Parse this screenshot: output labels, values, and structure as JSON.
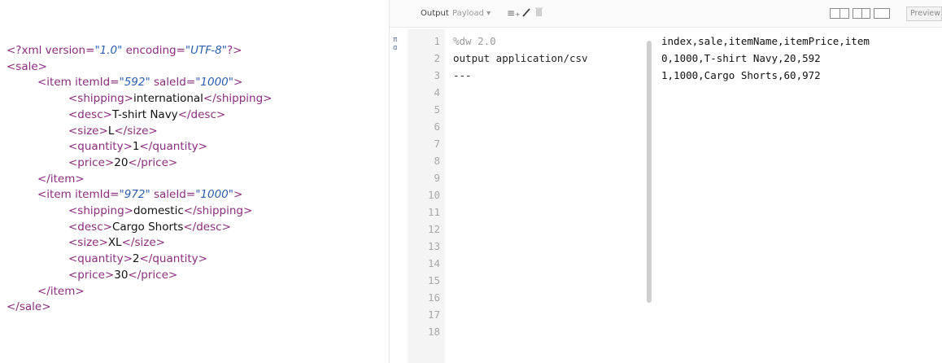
{
  "xml_source": {
    "lines": [
      {
        "indent": 0,
        "parts": [
          [
            "punct",
            "<?xml "
          ],
          [
            "attr",
            "version="
          ],
          [
            "aval",
            "\"1.0\""
          ],
          [
            "attr",
            " encoding="
          ],
          [
            "aval",
            "\"UTF-8\""
          ],
          [
            "punct",
            "?>"
          ]
        ]
      },
      {
        "indent": 0,
        "parts": [
          [
            "tag",
            "<sale>"
          ]
        ]
      },
      {
        "indent": 1,
        "parts": [
          [
            "tag",
            "<item "
          ],
          [
            "attr",
            "itemId="
          ],
          [
            "aval",
            "\"592\""
          ],
          [
            "attr",
            " saleId="
          ],
          [
            "aval",
            "\"1000\""
          ],
          [
            "tag",
            ">"
          ]
        ]
      },
      {
        "indent": 2,
        "parts": [
          [
            "tag",
            "<shipping>"
          ],
          [
            "txt",
            "international"
          ],
          [
            "tag",
            "</shipping>"
          ]
        ]
      },
      {
        "indent": 2,
        "parts": [
          [
            "tag",
            "<desc>"
          ],
          [
            "txt",
            "T-shirt Navy"
          ],
          [
            "tag",
            "</desc>"
          ]
        ]
      },
      {
        "indent": 2,
        "parts": [
          [
            "tag",
            "<size>"
          ],
          [
            "txt",
            "L"
          ],
          [
            "tag",
            "</size>"
          ]
        ]
      },
      {
        "indent": 2,
        "parts": [
          [
            "tag",
            "<quantity>"
          ],
          [
            "txt",
            "1"
          ],
          [
            "tag",
            "</quantity>"
          ]
        ]
      },
      {
        "indent": 2,
        "parts": [
          [
            "tag",
            "<price>"
          ],
          [
            "txt",
            "20"
          ],
          [
            "tag",
            "</price>"
          ]
        ]
      },
      {
        "indent": 1,
        "parts": [
          [
            "tag",
            "</item>"
          ]
        ]
      },
      {
        "indent": 1,
        "parts": [
          [
            "tag",
            "<item "
          ],
          [
            "attr",
            "itemId="
          ],
          [
            "aval",
            "\"972\""
          ],
          [
            "attr",
            " saleId="
          ],
          [
            "aval",
            "\"1000\""
          ],
          [
            "tag",
            ">"
          ]
        ]
      },
      {
        "indent": 2,
        "parts": [
          [
            "tag",
            "<shipping>"
          ],
          [
            "txt",
            "domestic"
          ],
          [
            "tag",
            "</shipping>"
          ]
        ]
      },
      {
        "indent": 2,
        "parts": [
          [
            "tag",
            "<desc>"
          ],
          [
            "txt",
            "Cargo Shorts"
          ],
          [
            "tag",
            "</desc>"
          ]
        ]
      },
      {
        "indent": 2,
        "parts": [
          [
            "tag",
            "<size>"
          ],
          [
            "txt",
            "XL"
          ],
          [
            "tag",
            "</size>"
          ]
        ]
      },
      {
        "indent": 2,
        "parts": [
          [
            "tag",
            "<quantity>"
          ],
          [
            "txt",
            "2"
          ],
          [
            "tag",
            "</quantity>"
          ]
        ]
      },
      {
        "indent": 2,
        "parts": [
          [
            "tag",
            "<price>"
          ],
          [
            "txt",
            "30"
          ],
          [
            "tag",
            "</price>"
          ]
        ]
      },
      {
        "indent": 1,
        "parts": [
          [
            "tag",
            "</item>"
          ]
        ]
      },
      {
        "indent": 0,
        "parts": [
          [
            "tag",
            "</sale>"
          ]
        ]
      }
    ]
  },
  "toolbar": {
    "output_label": "Output",
    "payload_label": "Payload ▾",
    "add_icon": "add-mapping-icon",
    "wand_icon": "magic-wand-icon",
    "trash_icon": "trash-icon",
    "preview_label": "Preview"
  },
  "side_markers": [
    "π",
    "ɑ"
  ],
  "editor": {
    "line_numbers": [
      "1",
      "2",
      "3",
      "4",
      "5",
      "6",
      "7",
      "8",
      "9",
      "10",
      "11",
      "12",
      "13",
      "14",
      "15",
      "16",
      "17",
      "18"
    ],
    "code": [
      {
        "text": "%dw 2.0",
        "muted": true
      },
      {
        "text": "output application/csv",
        "muted": false
      },
      {
        "text": "---",
        "muted": false
      }
    ]
  },
  "output": {
    "lines": [
      "index,sale,itemName,itemPrice,item",
      "0,1000,T-shirt Navy,20,592",
      "1,1000,Cargo Shorts,60,972"
    ]
  },
  "colors": {
    "tag": "#8b2d7d",
    "attr_value": "#2d5fae",
    "gutter_bg": "#f4f4f4",
    "line_number": "#a8a8a8"
  }
}
